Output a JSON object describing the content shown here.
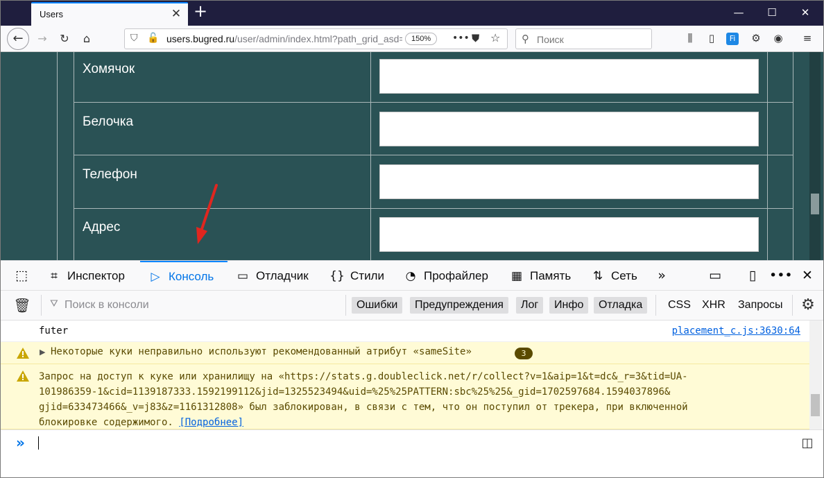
{
  "browser": {
    "tab_title": "Users",
    "tab_close": "✕",
    "new_tab": "+",
    "url_host": "users.bugred.ru",
    "url_path": "/user/admin/index.html?path_grid_asd=",
    "zoom": "150%",
    "search_placeholder": "Поиск",
    "window_controls": {
      "minimize": "—",
      "maximize": "☐",
      "close": "✕"
    }
  },
  "form": {
    "rows": [
      {
        "label": "Хомячок",
        "value": ""
      },
      {
        "label": "Белочка",
        "value": ""
      },
      {
        "label": "Телефон",
        "value": ""
      },
      {
        "label": "Адрес",
        "value": ""
      }
    ]
  },
  "devtools": {
    "tabs": {
      "inspector": "Инспектор",
      "console": "Консоль",
      "debugger": "Отладчик",
      "styles": "Стили",
      "profiler": "Профайлер",
      "memory": "Память",
      "network": "Сеть"
    },
    "filter_placeholder": "Поиск в консоли",
    "filters": {
      "errors": "Ошибки",
      "warnings": "Предупреждения",
      "log": "Лог",
      "info": "Инфо",
      "debug": "Отладка",
      "css": "CSS",
      "xhr": "XHR",
      "requests": "Запросы"
    },
    "messages": {
      "log_text": "futer",
      "log_source": "placement_c.js:3630:64",
      "warn1_text": "Некоторые куки неправильно используют рекомендованный атрибут «sameSite»",
      "warn1_count": "3",
      "warn2_line1": "Запрос на доступ к куке или хранилищу на «https://stats.g.doubleclick.net/r/collect?v=1&aip=1&t=dc&_r=3&tid=UA-",
      "warn2_line2": "101986359-1&cid=1139187333.1592199112&jid=1325523494&uid=%25%25PATTERN:sbc%25%25&_gid=1702597684.1594037896&",
      "warn2_line3": "gjid=633473466&_v=j83&z=1161312808» был заблокирован, в связи с тем, что он поступил от трекера, при включенной",
      "warn2_line4": "блокировке содержимого.",
      "warn2_link": "[Подробнее]"
    },
    "prompt": "»"
  },
  "colors": {
    "content_bg": "#2a5255",
    "accent": "#0a84ff",
    "warning_bg": "#fffbd6",
    "arrow": "#e0261f"
  }
}
